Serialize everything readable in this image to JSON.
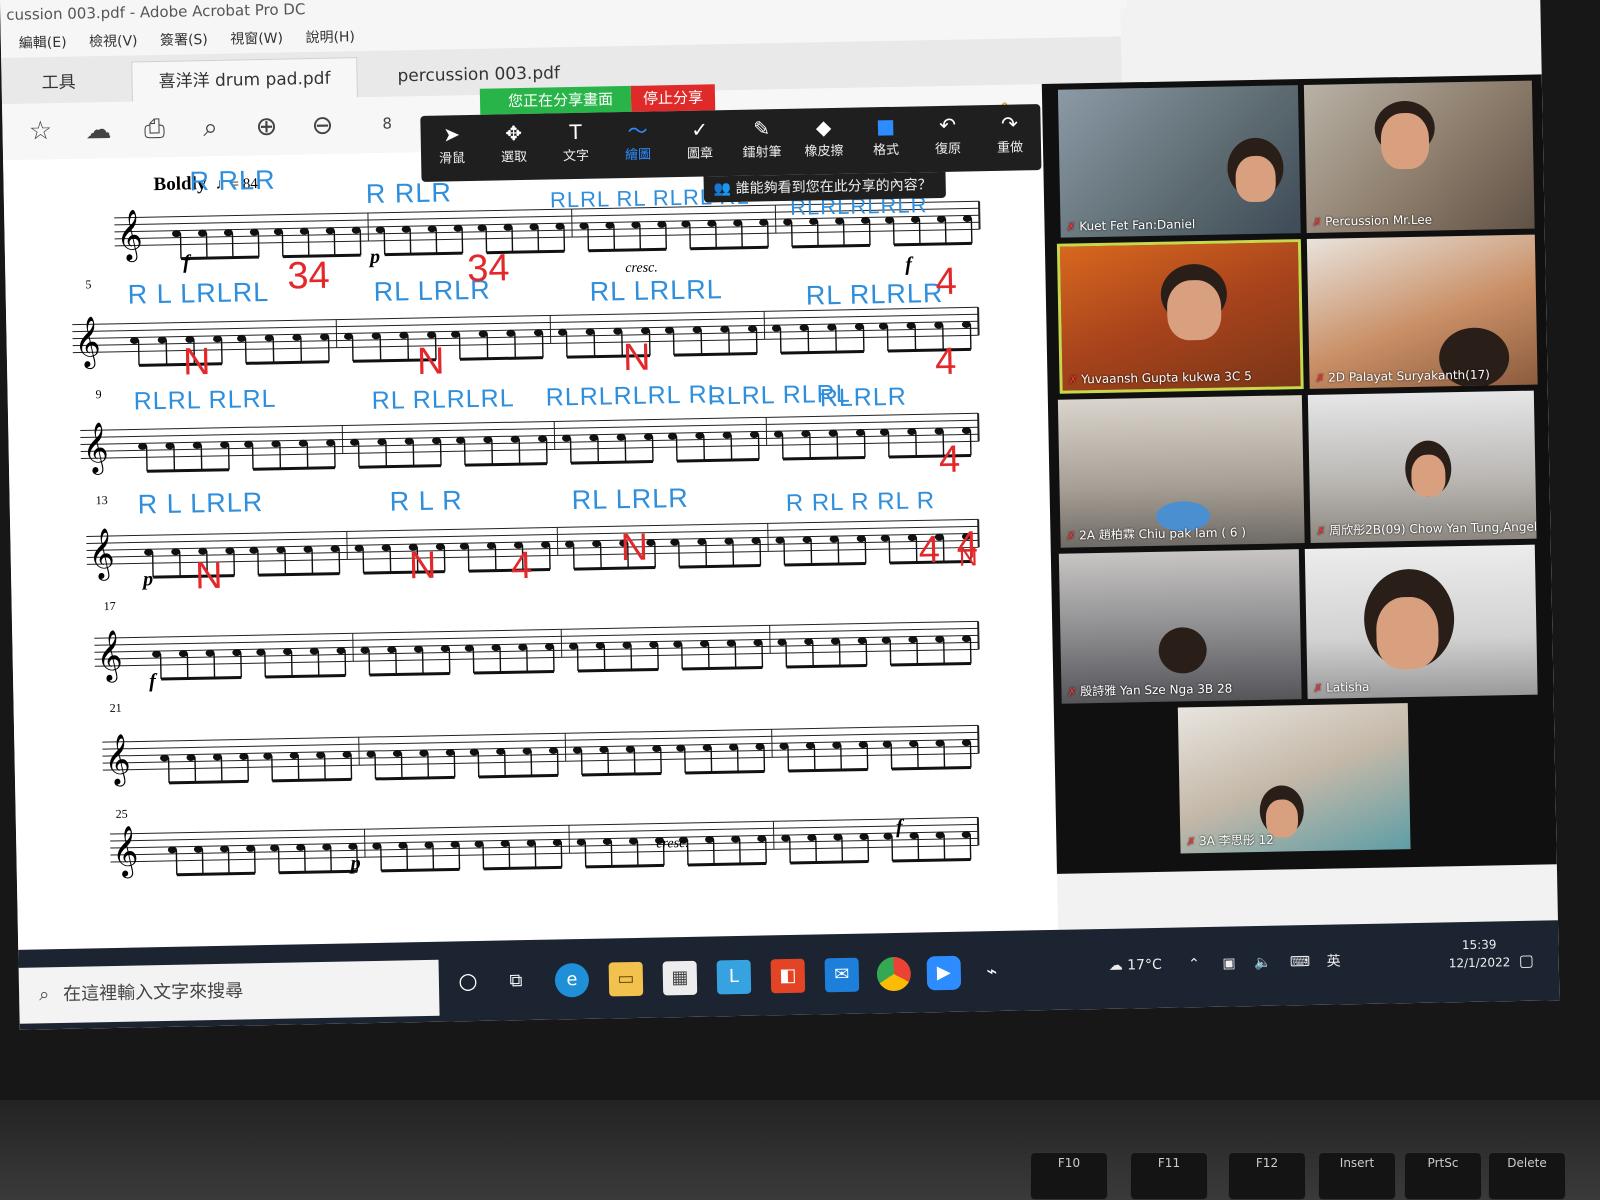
{
  "window": {
    "title": "cussion 003.pdf - Adobe Acrobat Pro DC",
    "menu": [
      "編輯(E)",
      "檢視(V)",
      "簽署(S)",
      "視窗(W)",
      "說明(H)"
    ]
  },
  "tabs": {
    "tools": "工具",
    "file1": "喜洋洋 drum pad.pdf",
    "file2": "percussion 003.pdf"
  },
  "toolbar": {
    "page_number": "8"
  },
  "zoom": {
    "sharing_label": "您正在分享畫面",
    "stop_label": "停止分享",
    "who_can_see": "誰能夠看到您在此分享的內容？",
    "annotate": [
      {
        "label": "滑鼠",
        "icon": "cursor-icon",
        "glyph": "➤"
      },
      {
        "label": "選取",
        "icon": "move-icon",
        "glyph": "✥"
      },
      {
        "label": "文字",
        "icon": "text-icon",
        "glyph": "T"
      },
      {
        "label": "繪圖",
        "icon": "draw-icon",
        "glyph": "～"
      },
      {
        "label": "圖章",
        "icon": "stamp-icon",
        "glyph": "✓"
      },
      {
        "label": "鐳射筆",
        "icon": "laser-icon",
        "glyph": "✎"
      },
      {
        "label": "橡皮擦",
        "icon": "eraser-icon",
        "glyph": "◆"
      },
      {
        "label": "格式",
        "icon": "format-icon",
        "glyph": "■"
      },
      {
        "label": "復原",
        "icon": "undo-icon",
        "glyph": "↶"
      },
      {
        "label": "重做",
        "icon": "redo-icon",
        "glyph": "↷"
      }
    ]
  },
  "score": {
    "tempo": "Boldly",
    "tempo_mark": "♩= 84",
    "measure_numbers": [
      "5",
      "9",
      "13",
      "17",
      "21",
      "25"
    ],
    "dynamics": {
      "f1": "f",
      "p1": "p",
      "cresc1": "cresc.",
      "f2": "f",
      "p2": "p",
      "f3": "f",
      "f4": "f",
      "p3": "p",
      "cresc2": "cresc."
    },
    "stickings": {
      "r1a": "R RLR",
      "r1b": "R RLR",
      "r1c": "RLRL RL RLRL RL",
      "r1d": "RLRLRLRLR",
      "r2a": "R L  LRLRL",
      "r2b": "RL  LRLR",
      "r2c": "RL  LRLRL",
      "r2d": "RL RLRLR",
      "r3a": "RLRL RLRL",
      "r3b": "RL RLRLRL",
      "r3c": "RLRLRLRL RL",
      "r3d": "RLRL RLRL",
      "r3e": "RLRLR",
      "r4a": "R L  LRLR",
      "r4b": "R L R",
      "r4c": "RL  LRLR",
      "r4d": "R RL R RL R"
    },
    "red_marks": {
      "m1": "34",
      "m2": "34",
      "m3": "4",
      "m4": "4",
      "m5": "4",
      "m6": "4",
      "m7": "4",
      "m8": "4",
      "n1": "N",
      "n2": "N",
      "n3": "N",
      "n4": "N",
      "n5": "N",
      "n6": "N",
      "n7": "N"
    }
  },
  "participants": [
    {
      "name": "Kuet  Fet  Fan:Daniel"
    },
    {
      "name": "Percussion Mr.Lee"
    },
    {
      "name": "Yuvaansh Gupta kukwa 3C 5"
    },
    {
      "name": "2D Palayat Suryakanth(17)"
    },
    {
      "name": "2A 趙柏霖 Chiu pak lam ( 6 )"
    },
    {
      "name": "周欣彤2B(09) Chow Yan Tung,Angel"
    },
    {
      "name": "殷詩雅 Yan Sze Nga 3B 28"
    },
    {
      "name": "Latisha"
    },
    {
      "name": "3A 李思彤 12"
    }
  ],
  "taskbar": {
    "search_placeholder": "在這裡輸入文字來搜尋",
    "temperature": "17°C",
    "ime": "英",
    "time": "15:39",
    "date": "12/1/2022"
  },
  "keyboard": {
    "keys": [
      "F10",
      "F11",
      "F12",
      "Insert",
      "PrtSc",
      "Delete"
    ]
  },
  "colors": {
    "sticking_blue": "#2f8fdc",
    "annotation_red": "#e3282b",
    "zoom_green": "#29b449",
    "zoom_red": "#e02a2a"
  }
}
